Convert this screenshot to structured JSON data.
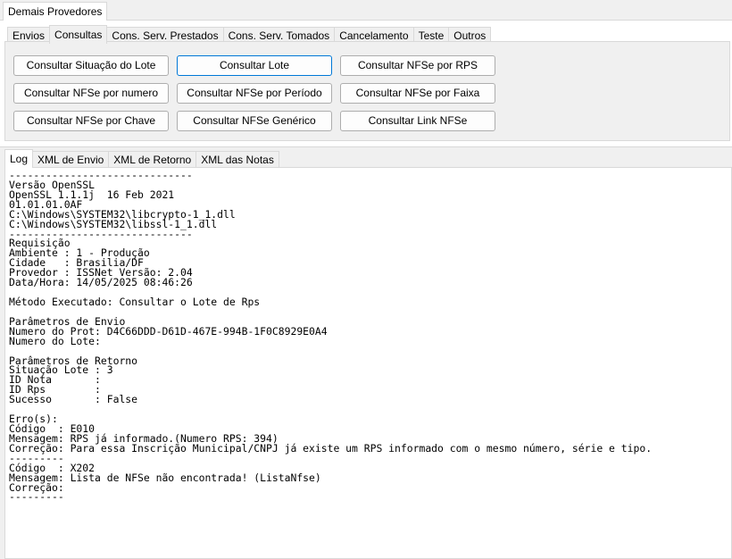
{
  "outer_tabs": [
    "Demais Provedores"
  ],
  "inner_tabs": [
    "Envios",
    "Consultas",
    "Cons. Serv. Prestados",
    "Cons. Serv. Tomados",
    "Cancelamento",
    "Teste",
    "Outros"
  ],
  "buttons": {
    "consultar_situacao_lote": "Consultar Situação do Lote",
    "consultar_lote": "Consultar Lote",
    "consultar_nfse_por_rps": "Consultar NFSe por RPS",
    "consultar_nfse_por_numero": "Consultar NFSe por numero",
    "consultar_nfse_por_periodo": "Consultar NFSe por Período",
    "consultar_nfse_por_faixa": "Consultar NFSe por Faixa",
    "consultar_nfse_por_chave": "Consultar NFSe por Chave",
    "consultar_nfse_generico": "Consultar NFSe Genérico",
    "consultar_link_nfse": "Consultar Link NFSe"
  },
  "log_tabs": [
    "Log",
    "XML de Envio",
    "XML de Retorno",
    "XML das Notas"
  ],
  "log_lines": [
    "------------------------------",
    "Versão OpenSSL",
    "OpenSSL 1.1.1j  16 Feb 2021",
    "01.01.01.0AF",
    "C:\\Windows\\SYSTEM32\\libcrypto-1_1.dll",
    "C:\\Windows\\SYSTEM32\\libssl-1_1.dll",
    "------------------------------",
    "Requisição",
    "Ambiente : 1 - Produção",
    "Cidade   : Brasilia/DF",
    "Provedor : ISSNet Versão: 2.04",
    "Data/Hora: 14/05/2025 08:46:26",
    "",
    "Método Executado: Consultar o Lote de Rps",
    "",
    "Parâmetros de Envio",
    "Numero do Prot: D4C66DDD-D61D-467E-994B-1F0C8929E0A4",
    "Numero do Lote:",
    "",
    "Parâmetros de Retorno",
    "Situação Lote : 3",
    "ID Nota       :",
    "ID Rps        :",
    "Sucesso       : False",
    "",
    "Erro(s):",
    "Código  : E010",
    "Mensagem: RPS já informado.(Numero RPS: 394)",
    "Correção: Para essa Inscrição Municipal/CNPJ já existe um RPS informado com o mesmo número, série e tipo.",
    "---------",
    "Código  : X202",
    "Mensagem: Lista de NFSe não encontrada! (ListaNfse)",
    "Correção:",
    "---------"
  ]
}
